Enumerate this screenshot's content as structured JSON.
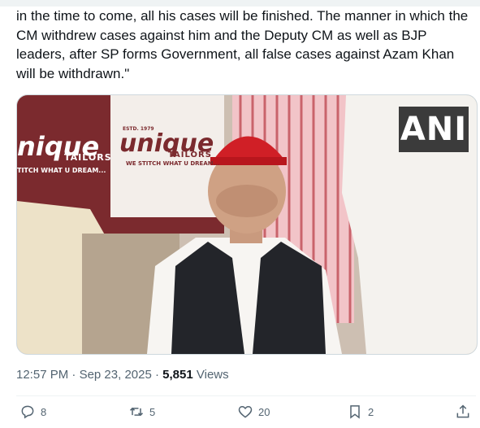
{
  "tweet": {
    "text": "in the time to come, all his cases will be finished. The manner in which the CM withdrew cases against him and the Deputy CM as well as BJP leaders, after SP forms Government, all false cases against Azam Khan will be withdrawn.\""
  },
  "media": {
    "watermark": "ANI",
    "banner_left_brand": "nique",
    "banner_left_sub": "TAILORS",
    "banner_left_slogan": "TITCH WHAT U DREAM...",
    "banner_right_estd": "ESTD. 1979",
    "banner_right_brand": "unique",
    "banner_right_sub": "TAILORS",
    "banner_right_slogan": "WE STITCH WHAT U DREAM..."
  },
  "meta": {
    "time": "12:57 PM",
    "separator": "·",
    "date": "Sep 23, 2025",
    "views_count": "5,851",
    "views_label": "Views"
  },
  "actions": {
    "replies": "8",
    "reposts": "5",
    "likes": "20",
    "bookmarks": "2",
    "share_icon": "share-icon"
  },
  "colors": {
    "text": "#0f1419",
    "secondary": "#536471",
    "divider": "#eff3f4",
    "cap_red": "#d01f26"
  }
}
